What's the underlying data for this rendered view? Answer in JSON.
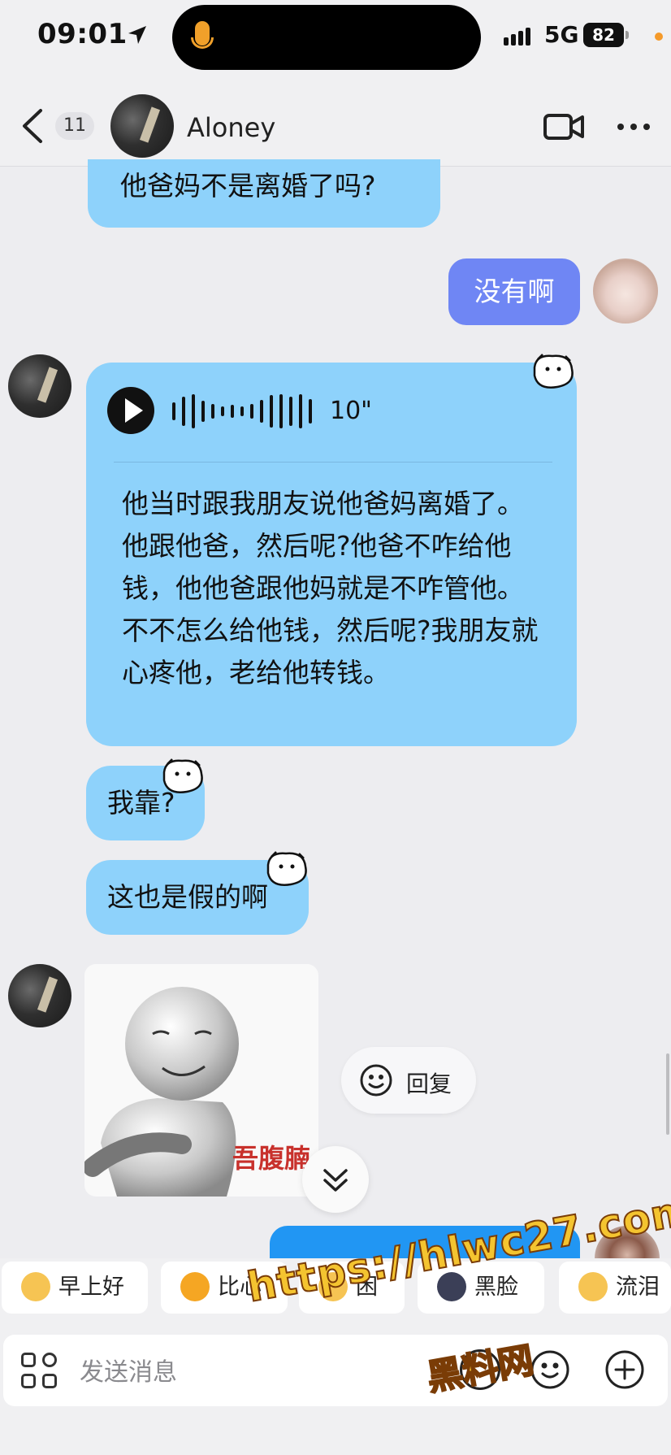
{
  "status_bar": {
    "time": "09:01",
    "network": "5G",
    "battery": "82"
  },
  "header": {
    "unread_count": "11",
    "contact_name": "Aloney"
  },
  "messages": {
    "m1_text": "他爸妈不是离婚了吗?",
    "m2_text": "没有啊",
    "voice_duration": "10\"",
    "transcript": "他当时跟我朋友说他爸妈离婚了。他跟他爸，然后呢?他爸不咋给他钱，他他爸跟他妈就是不咋管他。不不怎么给他钱，然后呢?我朋友就心疼他，老给他转钱。",
    "m4_text": "我靠?",
    "m5_text": "这也是假的啊",
    "meme_caption": "吾腹腩"
  },
  "reply_pill": {
    "label": "回复"
  },
  "quick_replies": [
    {
      "label": "早上好",
      "color": "#f6c453"
    },
    {
      "label": "比心",
      "color": "#f5a623"
    },
    {
      "label": "困",
      "color": "#f6c453"
    },
    {
      "label": "黑脸",
      "color": "#3b3f57"
    },
    {
      "label": "流泪",
      "color": "#f6c453"
    }
  ],
  "input": {
    "placeholder": "发送消息"
  },
  "watermark": {
    "url": "https://hlwc27.com",
    "site": "黑料网"
  },
  "colors": {
    "incoming_bubble": "#8ed2fb",
    "outgoing_bubble": "#6f86f4",
    "accent_blue": "#2196f3",
    "background": "#ededf0"
  }
}
